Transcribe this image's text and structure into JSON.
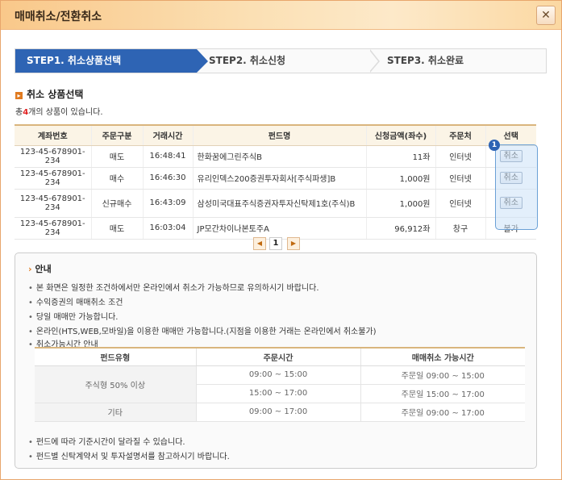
{
  "window": {
    "title": "매매취소/전환취소",
    "close_icon": "close-icon"
  },
  "steps": [
    {
      "label": "STEP1. 취소상품선택",
      "active": true
    },
    {
      "label": "STEP2. 취소신청",
      "active": false
    },
    {
      "label": "STEP3. 취소완료",
      "active": false
    }
  ],
  "section": {
    "title": "취소 상품선택",
    "summary_prefix": "총",
    "summary_count": "4",
    "summary_suffix": "개의 상품이 있습니다."
  },
  "table": {
    "headers": [
      "계좌번호",
      "주문구분",
      "거래시간",
      "펀드명",
      "신청금액(좌수)",
      "주문처",
      "선택"
    ],
    "rows": [
      {
        "account": "123-45-678901-234",
        "order_type": "매도",
        "time": "16:48:41",
        "fund": "한화꿈에그린주식B",
        "amount": "11좌",
        "channel": "인터넷",
        "select": "취소",
        "select_type": "button"
      },
      {
        "account": "123-45-678901-234",
        "order_type": "매수",
        "time": "16:46:30",
        "fund": "유리인덱스200증권투자회사[주식파생]B",
        "amount": "1,000원",
        "channel": "인터넷",
        "select": "취소",
        "select_type": "button"
      },
      {
        "account": "123-45-678901-234",
        "order_type": "신규매수",
        "time": "16:43:09",
        "fund": "삼성미국대표주식증권자투자신탁제1호(주식)B",
        "amount": "1,000원",
        "channel": "인터넷",
        "select": "취소",
        "select_type": "button"
      },
      {
        "account": "123-45-678901-234",
        "order_type": "매도",
        "time": "16:03:04",
        "fund": "JP모간차이나본토주A",
        "amount": "96,912좌",
        "channel": "창구",
        "select": "불가",
        "select_type": "text"
      }
    ],
    "highlight_badge": "1"
  },
  "pager": {
    "first_icon": "first-page-icon",
    "current": "1",
    "last_icon": "last-page-icon"
  },
  "guide": {
    "title": "안내",
    "lines": [
      "본 화면은 일정한 조건하에서만 온라인에서 취소가 가능하므로 유의하시기 바랍니다.",
      "수익증권의 매매취소 조건",
      "당일 매매만 가능합니다.",
      "온라인(HTS,WEB,모바일)을 이용한 매매만 가능합니다.(지점을 이용한 거래는 온라인에서 취소불가)",
      "취소가능시간 안내"
    ],
    "hours_table": {
      "headers": [
        "펀드유형",
        "주문시간",
        "매매취소 가능시간"
      ],
      "rows": [
        {
          "type": "주식형 50% 이상",
          "order": "09:00 ~ 15:00",
          "cancel": "주문일 09:00 ~ 15:00"
        },
        {
          "type": "",
          "order": "15:00 ~ 17:00",
          "cancel": "주문일 15:00 ~ 17:00"
        },
        {
          "type": "기타",
          "order": "09:00 ~ 17:00",
          "cancel": "주문일 09:00 ~ 17:00"
        }
      ]
    },
    "footer_lines": [
      "펀드에 따라 기준시간이 달라질 수 있습니다.",
      "펀드별 신탁계약서 및 투자설명서를 참고하시기 바랍니다."
    ]
  },
  "colors": {
    "accent": "#2e64b4",
    "orange": "#e07a1f",
    "count_red": "#e02020"
  }
}
